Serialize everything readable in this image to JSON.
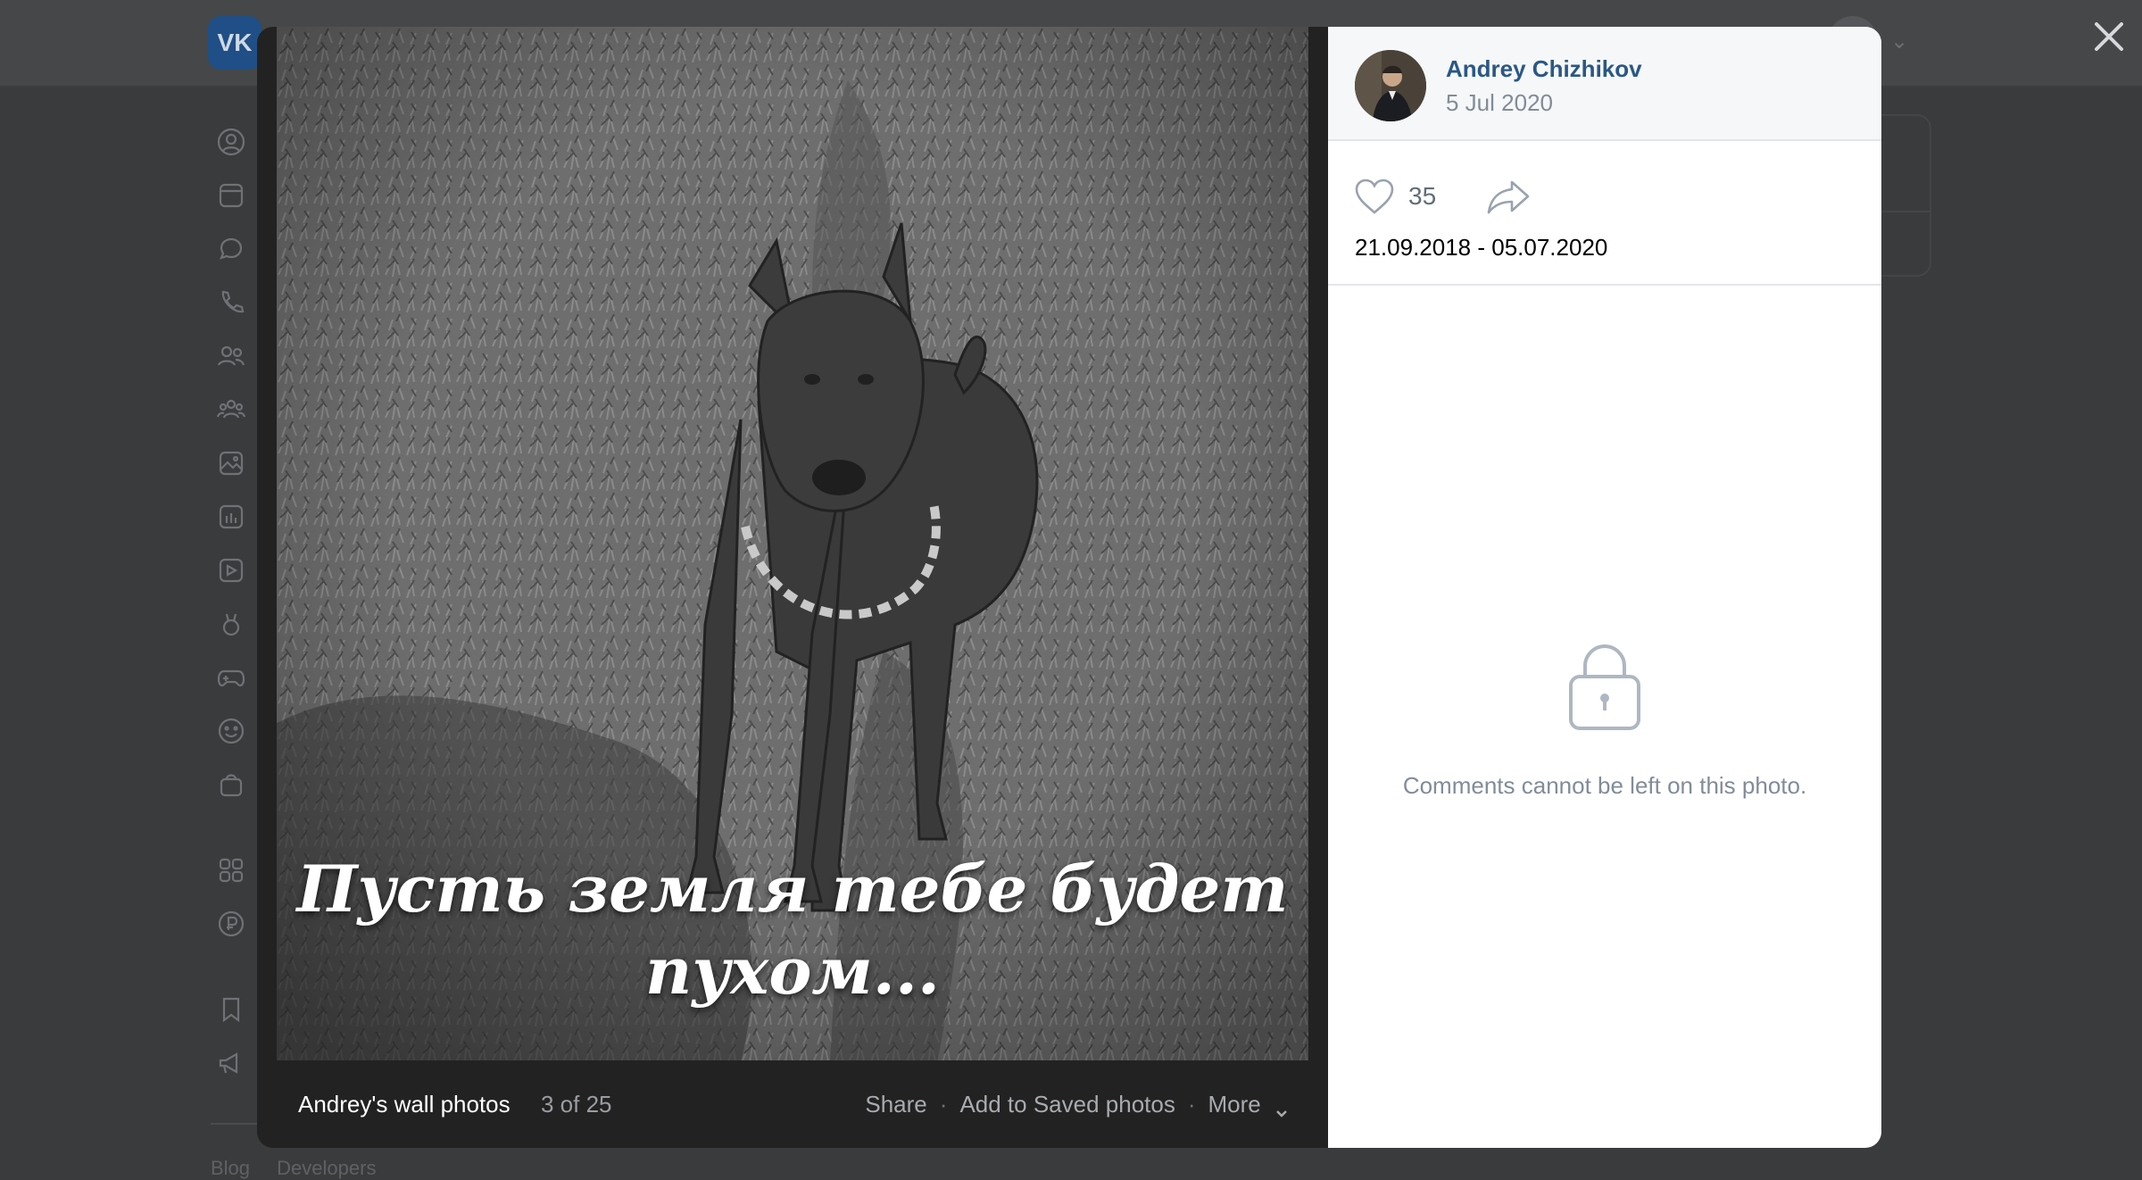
{
  "author": {
    "name": "Andrey Chizhikov",
    "date": "5 Jul 2020"
  },
  "photo": {
    "caption_line1": "Пусть земля тебе будет",
    "caption_line2": "пухом...",
    "likes": "35",
    "description": "21.09.2018 - 05.07.2020"
  },
  "bottom_bar": {
    "album": "Andrey's wall photos",
    "counter": "3 of 25",
    "share": "Share",
    "add_saved": "Add to Saved photos",
    "more": "More"
  },
  "comments": {
    "locked_text": "Comments cannot be left on this photo."
  },
  "background_page": {
    "logo": "VK",
    "footer_links": [
      "Blog",
      "Developers"
    ]
  },
  "colors": {
    "link": "#2a5885",
    "muted": "#818c99",
    "overlay": "#3a3b3d"
  }
}
